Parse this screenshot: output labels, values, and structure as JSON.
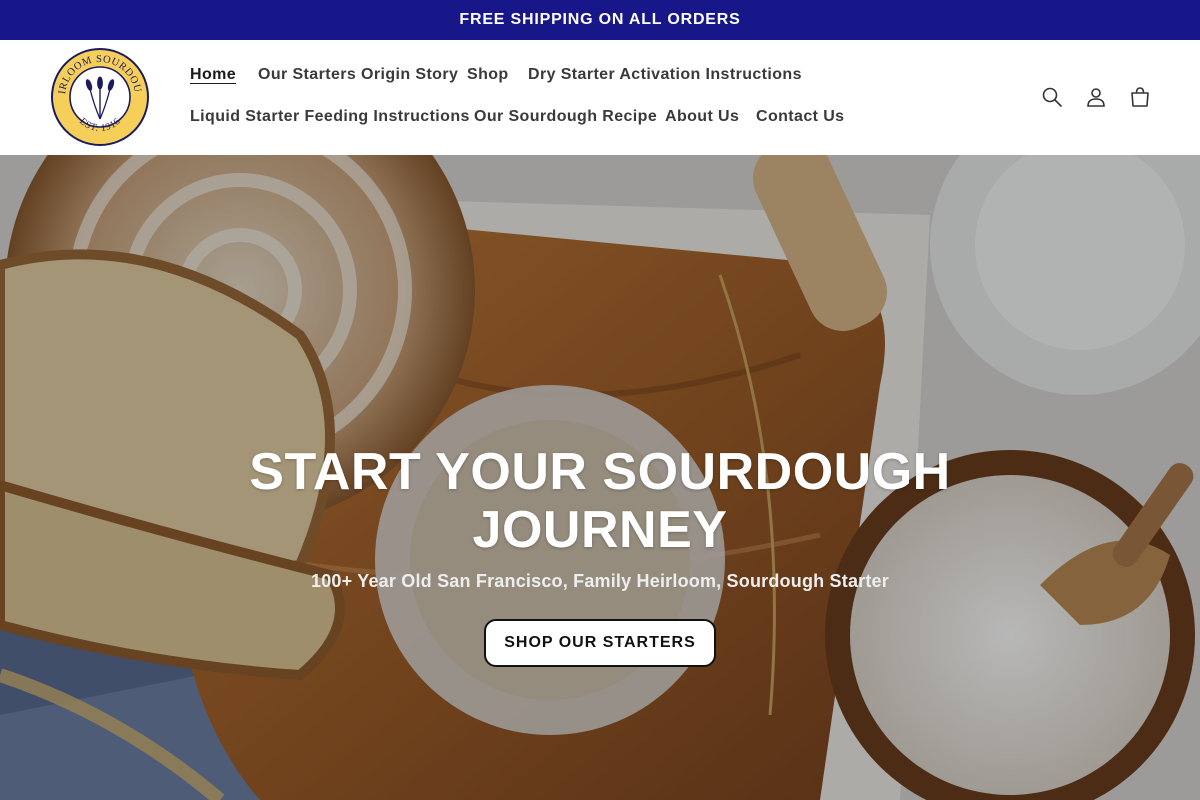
{
  "announcement": {
    "text": "FREE SHIPPING ON ALL ORDERS"
  },
  "logo": {
    "ring_text": "HEIRLOOM SOURDOUGH",
    "est_text": "EST. 1916",
    "icon": "wheat-icon"
  },
  "nav": {
    "items": [
      {
        "label": "Home",
        "active": true
      },
      {
        "label": "Our Starters Origin Story"
      },
      {
        "label": "Shop"
      },
      {
        "label": "Dry Starter Activation Instructions"
      },
      {
        "label": "Liquid Starter Feeding Instructions"
      },
      {
        "label": "Our Sourdough Recipe"
      },
      {
        "label": "About Us"
      },
      {
        "label": "Contact Us"
      }
    ]
  },
  "header_icons": [
    "search-icon",
    "account-icon",
    "cart-icon"
  ],
  "hero": {
    "heading": "START YOUR SOURDOUGH JOURNEY",
    "subheading": "100+ Year Old San Francisco, Family Heirloom, Sourdough Starter",
    "button_label": "SHOP OUR STARTERS"
  },
  "colors": {
    "announcement_bg": "#17178a",
    "logo_yellow": "#f6cf5a",
    "logo_navy": "#1b1b5e",
    "text_dark": "#3a3a3a"
  }
}
